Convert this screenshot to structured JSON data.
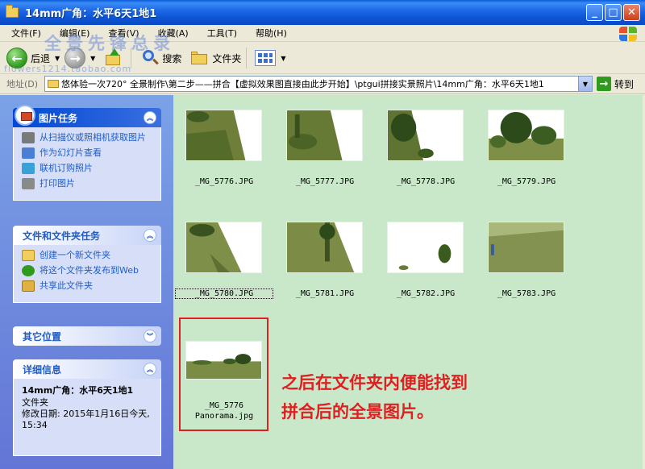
{
  "window": {
    "title": "14mm广角：水平6天1地1",
    "minimize_glyph": "_",
    "maximize_glyph": "□",
    "close_glyph": "✕"
  },
  "menu": [
    "文件(F)",
    "编辑(E)",
    "查看(V)",
    "收藏(A)",
    "工具(T)",
    "帮助(H)"
  ],
  "toolbar": {
    "back_label": "后退",
    "search_label": "搜索",
    "folders_label": "文件夹",
    "back_glyph": "←",
    "forward_glyph": "→"
  },
  "address": {
    "label": "地址(D)",
    "value": "悠体验一次720° 全景制作\\第二步——拼合【虚拟效果图直接由此步开始】\\ptgui拼接实景照片\\14mm广角：水平6天1地1",
    "go_label": "转到",
    "go_glyph": "→"
  },
  "watermark": {
    "text": "全景先锋总录",
    "url": "flowers1214.taobao.com"
  },
  "left_pane": {
    "picture_tasks": {
      "title": "图片任务",
      "items": [
        {
          "label": "从扫描仪或照相机获取图片",
          "icon": "camera-icon",
          "color": "#7a7a7a"
        },
        {
          "label": "作为幻灯片查看",
          "icon": "slideshow-icon",
          "color": "#4a7fd4"
        },
        {
          "label": "联机订购照片",
          "icon": "order-prints-icon",
          "color": "#3aa0d8"
        },
        {
          "label": "打印图片",
          "icon": "printer-icon",
          "color": "#8a8a8a"
        }
      ]
    },
    "file_tasks": {
      "title": "文件和文件夹任务",
      "items": [
        {
          "label": "创建一个新文件夹",
          "icon": "new-folder-icon",
          "color": "#f2cf5c"
        },
        {
          "label": "将这个文件夹发布到Web",
          "icon": "publish-web-icon",
          "color": "#2f9a1e"
        },
        {
          "label": "共享此文件夹",
          "icon": "share-folder-icon",
          "color": "#e0b040"
        }
      ]
    },
    "other_places": {
      "title": "其它位置"
    },
    "details": {
      "title": "详细信息",
      "name": "14mm广角：水平6天1地1",
      "type": "文件夹",
      "modified": "修改日期: 2015年1月16日今天, 15:34"
    },
    "collapse_up_glyph": "︽",
    "collapse_down_glyph": "︾"
  },
  "files": [
    {
      "name": "_MG_5776.JPG",
      "scene": "pano-a"
    },
    {
      "name": "_MG_5777.JPG",
      "scene": "pano-b"
    },
    {
      "name": "_MG_5778.JPG",
      "scene": "pano-c"
    },
    {
      "name": "_MG_5779.JPG",
      "scene": "pano-d"
    },
    {
      "name": "_MG_5780.JPG",
      "scene": "ground-a"
    },
    {
      "name": "_MG_5781.JPG",
      "scene": "ground-b"
    },
    {
      "name": "_MG_5782.JPG",
      "scene": "sky"
    },
    {
      "name": "_MG_5783.JPG",
      "scene": "ground-c"
    }
  ],
  "panorama": {
    "name_line1": "_MG_5776",
    "name_line2": "Panorama.jpg"
  },
  "annotation": {
    "line1": "之后在文件夹内便能找到",
    "line2": "拼合后的全景图片。",
    "color": "#e02020"
  }
}
